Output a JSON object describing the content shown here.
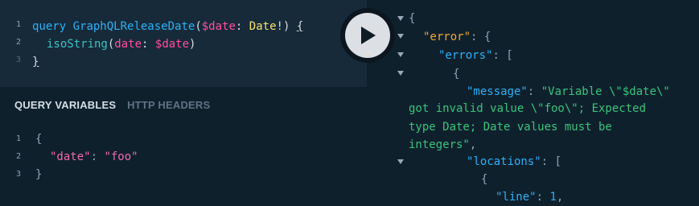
{
  "query_editor": {
    "line_numbers": [
      "1",
      "2",
      "3"
    ],
    "l1": {
      "kw": "query",
      "name": "GraphQLReleaseDate",
      "open": "(",
      "var": "$date",
      "colon": ":",
      "type": "Date",
      "bang": "!",
      "close": ")",
      "brace": "{"
    },
    "l2": {
      "field": "isoString",
      "open": "(",
      "arg": "date",
      "colon": ":",
      "var": "$date",
      "close": ")"
    },
    "l3": {
      "brace": "}"
    }
  },
  "variables": {
    "tabs": {
      "active": "QUERY VARIABLES",
      "inactive": "HTTP HEADERS"
    },
    "line_numbers": [
      "1",
      "2",
      "3"
    ],
    "l1": "{",
    "l2": {
      "key": "\"date\"",
      "colon": ":",
      "value": "\"foo\""
    },
    "l3": "}"
  },
  "play_button": {
    "icon": "play-icon"
  },
  "response": {
    "lines": {
      "r1": "{",
      "r2_key": "\"error\"",
      "r2_rest": ": {",
      "r3_key": "\"errors\"",
      "r3_rest": ": [",
      "r4": "{",
      "r5_key": "\"message\"",
      "r5_colon": ": ",
      "r5_val": "\"Variable \\\"$date\\\"",
      "r6": "got invalid value \\\"foo\\\"; Expected",
      "r7": "type Date; Date values must be",
      "r8_val": "integers\"",
      "r8_rest": ",",
      "r9_key": "\"locations\"",
      "r9_rest": ": [",
      "r10": "{",
      "r11_key": "\"line\"",
      "r11_colon": ": ",
      "r11_val": "1",
      "r11_rest": ","
    },
    "fold_icon": "triangle-down-icon"
  }
}
